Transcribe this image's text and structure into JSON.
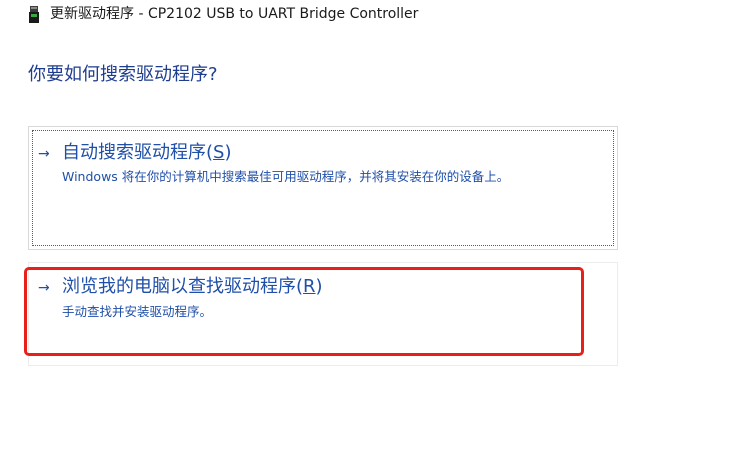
{
  "window": {
    "title": "更新驱动程序 - CP2102 USB to UART Bridge Controller",
    "icon": "usb-device-icon"
  },
  "page": {
    "heading": "你要如何搜索驱动程序?"
  },
  "options": [
    {
      "arrow": "→",
      "title_prefix": "自动搜索驱动程序(",
      "accelerator": "S",
      "title_suffix": ")",
      "description": "Windows 将在你的计算机中搜索最佳可用驱动程序，并将其安装在你的设备上。"
    },
    {
      "arrow": "→",
      "title_prefix": "浏览我的电脑以查找驱动程序(",
      "accelerator": "R",
      "title_suffix": ")",
      "description": "手动查找并安装驱动程序。"
    }
  ],
  "colors": {
    "heading": "#1f3d8f",
    "link": "#1f4fa8",
    "highlight": "#e8201c"
  }
}
